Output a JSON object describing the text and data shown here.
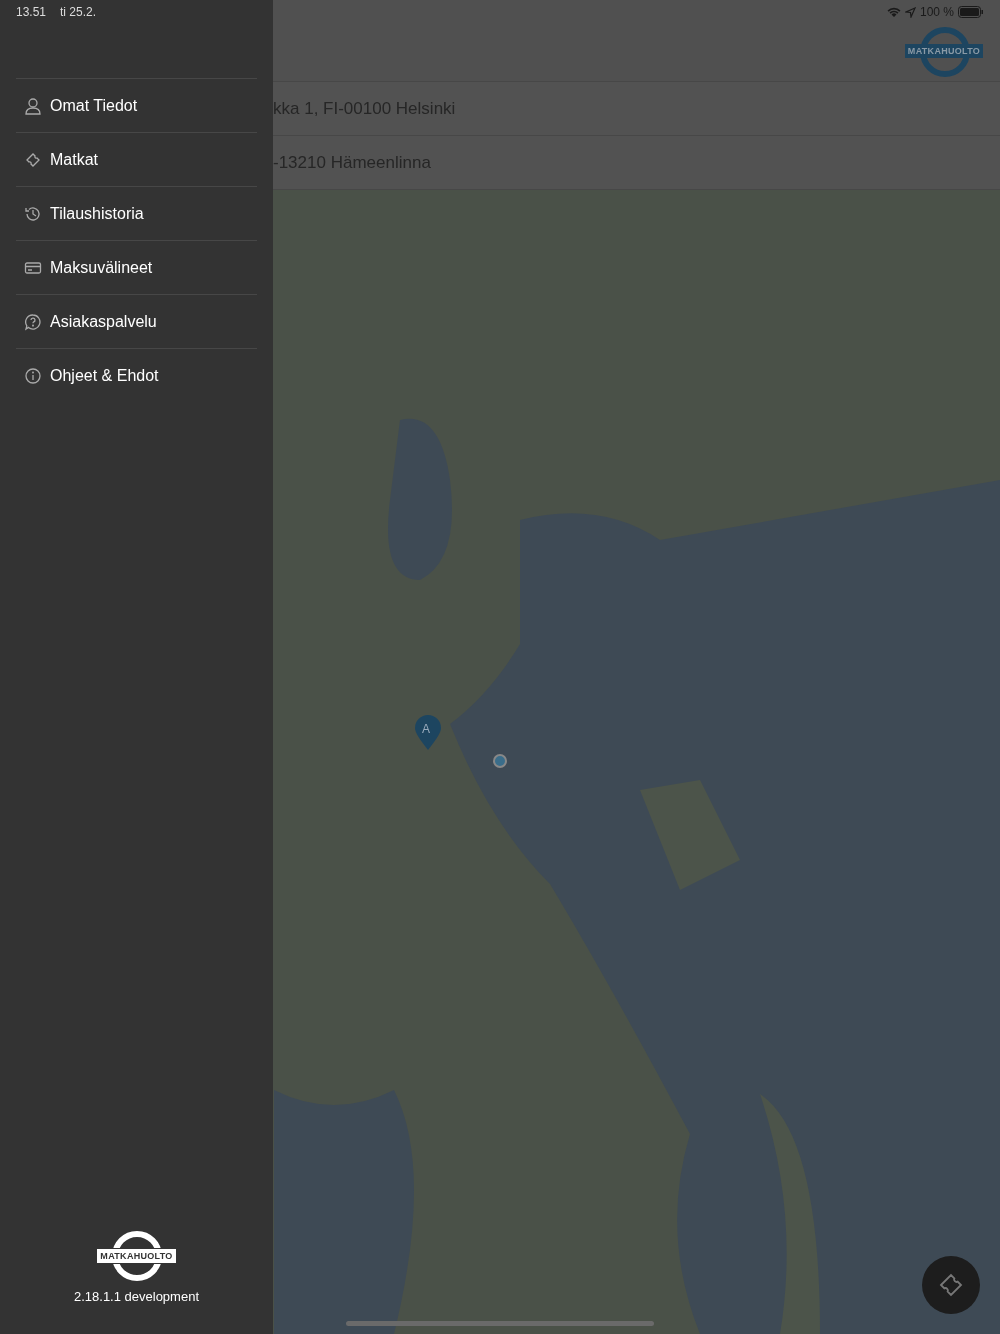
{
  "status_bar": {
    "time": "13.51",
    "date": "ti 25.2.",
    "battery": "100 %"
  },
  "header": {
    "logo": "MATKAHUOLTO"
  },
  "addresses": [
    {
      "text": "kka 1, FI-00100 Helsinki"
    },
    {
      "text": "-13210 Hämeenlinna"
    }
  ],
  "map": {
    "pin_label": "A"
  },
  "side_menu": {
    "items": [
      {
        "label": "Omat Tiedot",
        "kind": "person"
      },
      {
        "label": "Matkat",
        "kind": "ticket"
      },
      {
        "label": "Tilaushistoria",
        "kind": "history"
      },
      {
        "label": "Maksuvälineet",
        "kind": "card"
      },
      {
        "label": "Asiakaspalvelu",
        "kind": "help"
      },
      {
        "label": "Ohjeet & Ehdot",
        "kind": "info"
      }
    ],
    "logo": "MATKAHUOLTO",
    "version": "2.18.1.1 development"
  }
}
